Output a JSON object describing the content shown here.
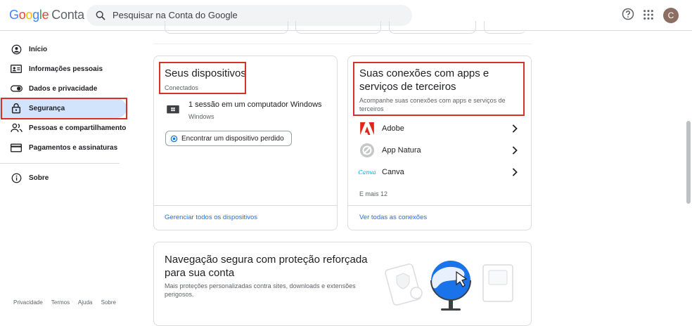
{
  "header": {
    "logo_google": "Google",
    "logo_product": "Conta",
    "search_placeholder": "Pesquisar na Conta do Google",
    "avatar_letter": "C"
  },
  "sidebar": {
    "items": [
      {
        "label": "Início",
        "icon": "home-icon"
      },
      {
        "label": "Informações pessoais",
        "icon": "id-card-icon"
      },
      {
        "label": "Dados e privacidade",
        "icon": "toggle-icon"
      },
      {
        "label": "Segurança",
        "icon": "lock-icon"
      },
      {
        "label": "Pessoas e compartilhamento",
        "icon": "people-icon"
      },
      {
        "label": "Pagamentos e assinaturas",
        "icon": "credit-card-icon"
      },
      {
        "label": "Sobre",
        "icon": "info-icon"
      }
    ],
    "footer": [
      "Privacidade",
      "Termos",
      "Ajuda",
      "Sobre"
    ]
  },
  "devices_card": {
    "title": "Seus dispositivos",
    "subtitle": "Conectados",
    "session_text": "1 sessão em um computador Windows",
    "session_os": "Windows",
    "find_button": "Encontrar um dispositivo perdido",
    "manage_link": "Gerenciar todos os dispositivos"
  },
  "connections_card": {
    "title": "Suas conexões com apps e serviços de terceiros",
    "subtitle": "Acompanhe suas conexões com apps e serviços de terceiros",
    "apps": [
      {
        "name": "Adobe"
      },
      {
        "name": "App Natura"
      },
      {
        "name": "Canva",
        "logo_text": "Canva"
      }
    ],
    "more": "E mais 12",
    "see_all_link": "Ver todas as conexões"
  },
  "safe_browsing_card": {
    "title": "Navegação segura com proteção reforçada para sua conta",
    "description": "Mais proteções personalizadas contra sites, downloads e extensões perigosos."
  },
  "colors": {
    "accent": "#1a73e8",
    "highlight": "#d93025",
    "active_nav": "#d2e3fc"
  }
}
